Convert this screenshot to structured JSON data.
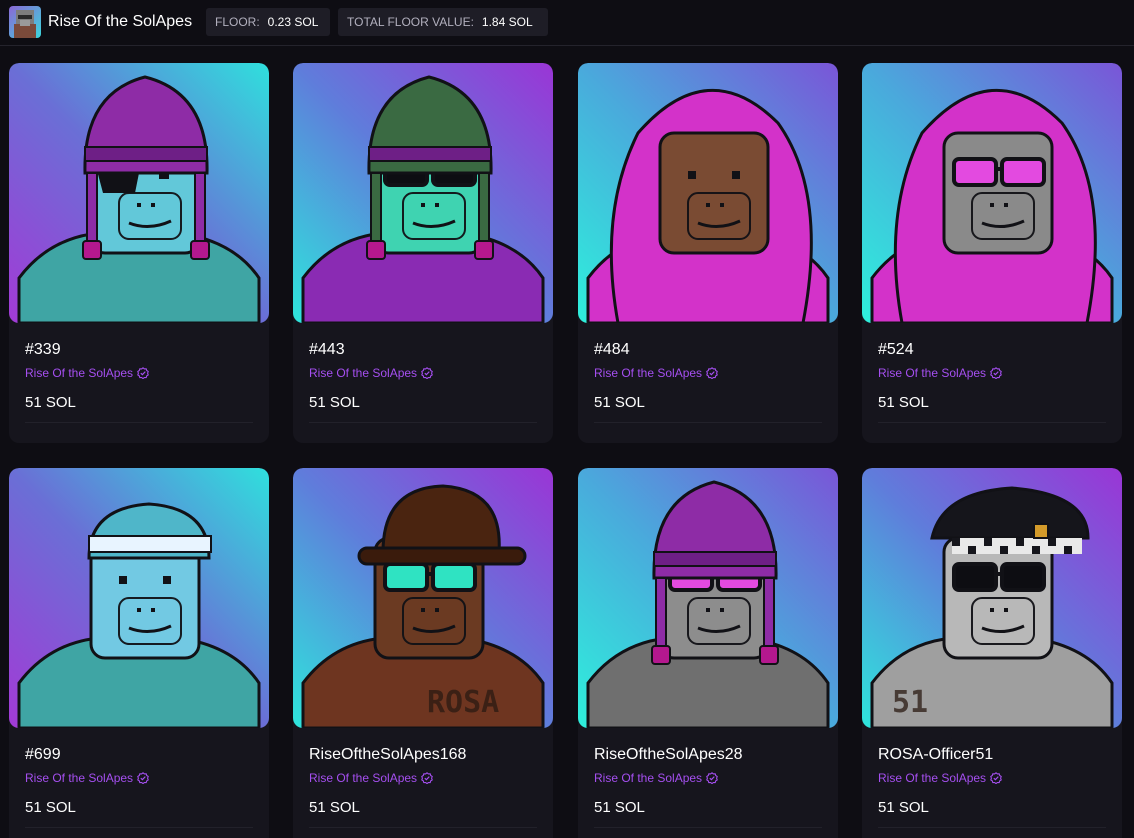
{
  "collection": {
    "name": "Rise Of the SolApes",
    "floor_label": "FLOOR:",
    "floor_value": "0.23 SOL",
    "total_label": "TOTAL FLOOR VALUE:",
    "total_value": "1.84 SOL"
  },
  "cards": [
    {
      "name": "#339",
      "collection": "Rise Of the SolApes",
      "price": "51 SOL",
      "art": {
        "fur": "#62c8d9",
        "hat": "beanie",
        "hatColor": "#8e2ca6",
        "eyes": "eyepatch",
        "shirt": "#3fa5a4",
        "bg": "teal-purple"
      }
    },
    {
      "name": "#443",
      "collection": "Rise Of the SolApes",
      "price": "51 SOL",
      "art": {
        "fur": "#3fd3b1",
        "hat": "beanie",
        "hatColor": "#3a6a42",
        "eyes": "shades",
        "shirt": "#8a2bb3",
        "bg": "purple-teal"
      }
    },
    {
      "name": "#484",
      "collection": "Rise Of the SolApes",
      "price": "51 SOL",
      "art": {
        "fur": "#7a4b33",
        "hat": "hood",
        "hatColor": "#d332c9",
        "eyes": "none",
        "shirt": "#d332c9",
        "bg": "blue-teal"
      }
    },
    {
      "name": "#524",
      "collection": "Rise Of the SolApes",
      "price": "51 SOL",
      "art": {
        "fur": "#8a8a8a",
        "hat": "hood",
        "hatColor": "#d332c9",
        "eyes": "pink-shades",
        "shirt": "#d332c9",
        "bg": "blue-teal"
      }
    },
    {
      "name": "#699",
      "collection": "Rise Of the SolApes",
      "price": "51 SOL",
      "art": {
        "fur": "#72c9e3",
        "hat": "headband",
        "hatColor": "#4fb6c9",
        "eyes": "none",
        "shirt": "#3fa5a4",
        "bg": "teal-purple"
      }
    },
    {
      "name": "RiseOftheSolApes168",
      "collection": "Rise Of the SolApes",
      "price": "51 SOL",
      "art": {
        "fur": "#6b3a22",
        "hat": "bowler",
        "hatColor": "#4a2410",
        "eyes": "teal-shades",
        "shirt": "#6e3520",
        "bg": "purple-teal",
        "shirtText": "ROSA"
      }
    },
    {
      "name": "RiseOftheSolApes28",
      "collection": "Rise Of the SolApes",
      "price": "51 SOL",
      "art": {
        "fur": "#8d8d8d",
        "hat": "beanie",
        "hatColor": "#8e2ca6",
        "eyes": "pink-shades",
        "shirt": "#6f6f6f",
        "bg": "blue-teal"
      }
    },
    {
      "name": "ROSA-Officer51",
      "collection": "Rise Of the SolApes",
      "price": "51 SOL",
      "art": {
        "fur": "#b8b8b8",
        "hat": "police",
        "hatColor": "#15151b",
        "eyes": "shades",
        "shirt": "#9f9f9f",
        "bg": "purple-teal",
        "shirtText": "51"
      }
    }
  ]
}
